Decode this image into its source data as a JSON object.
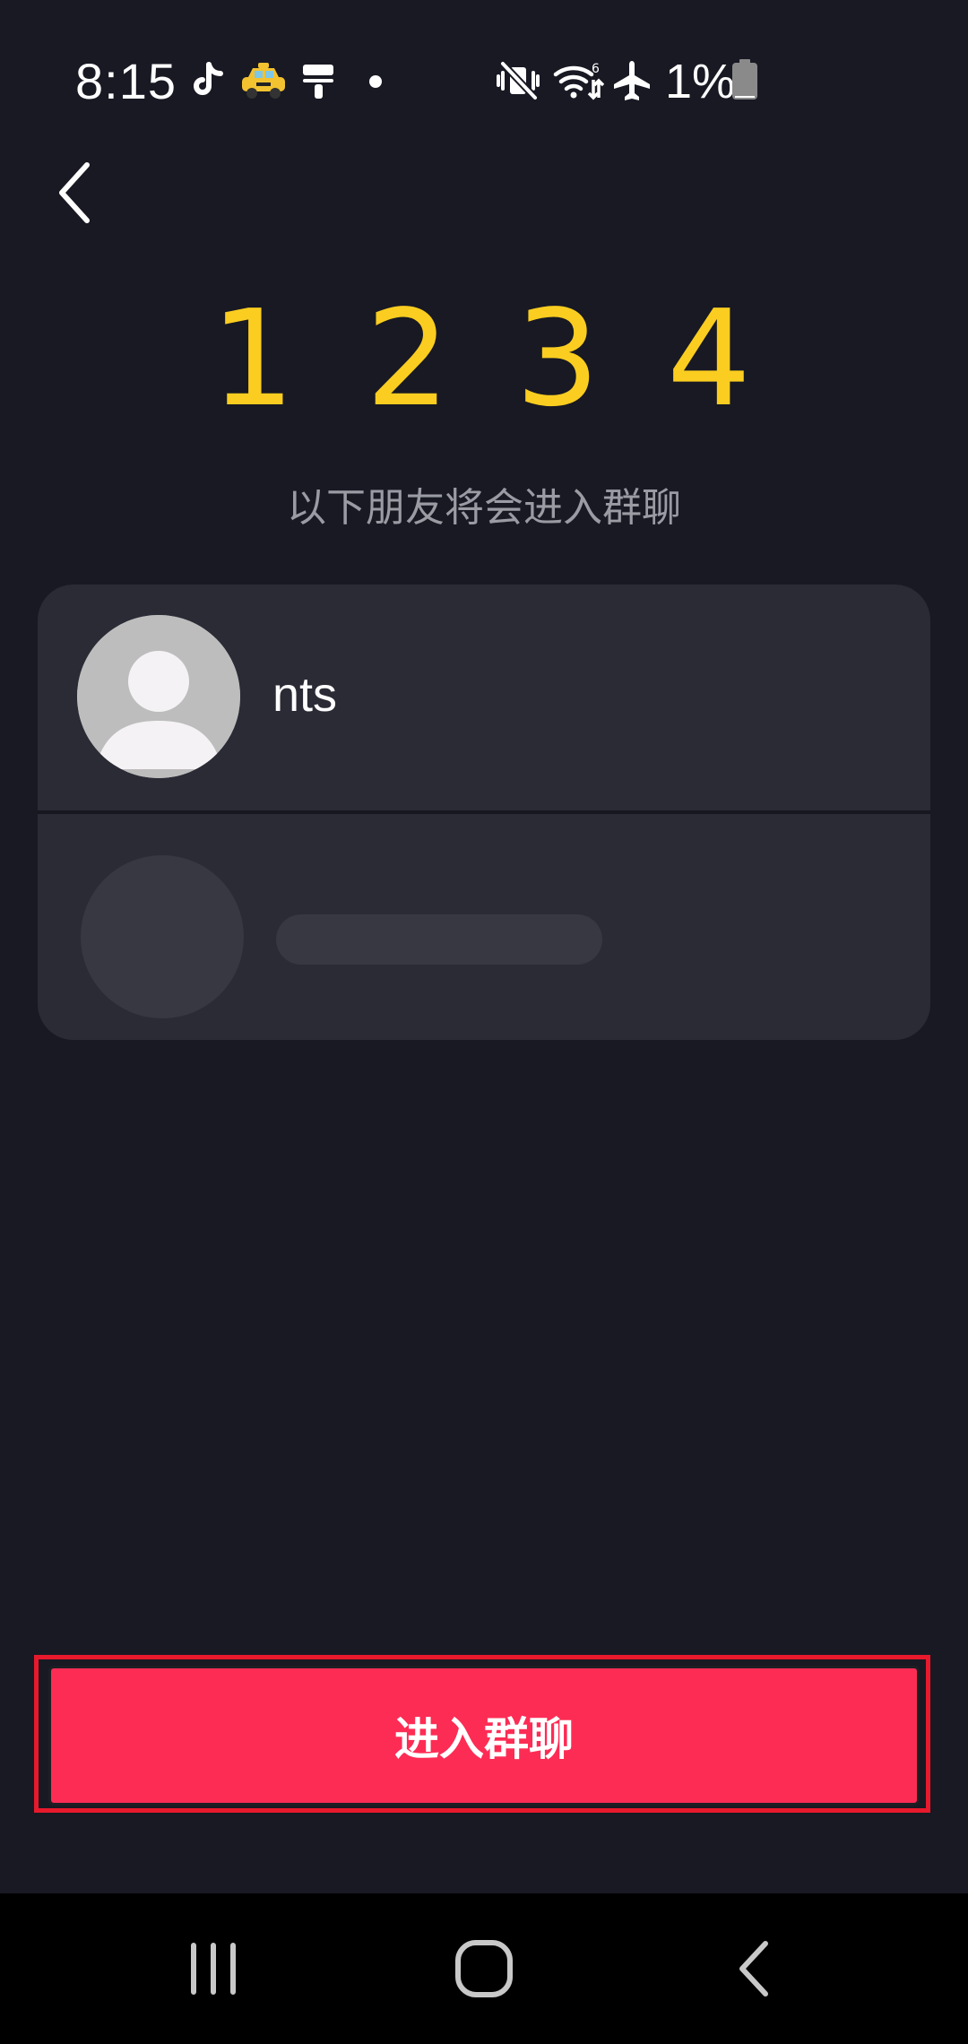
{
  "status_bar": {
    "time": "8:15",
    "battery_percent": "1%",
    "notification_icons": [
      "tiktok-icon",
      "taxi-icon",
      "paint-roller-icon",
      "more-dot-icon"
    ],
    "system_icons": [
      "vibrate-mute-icon",
      "wifi-6-icon",
      "airplane-mode-icon",
      "battery-low-icon"
    ]
  },
  "header": {
    "back_icon": "chevron-left-icon"
  },
  "code": {
    "digits": [
      "1",
      "2",
      "3",
      "4"
    ],
    "digit_color": "#facd20"
  },
  "subtitle": "以下朋友将会进入群聊",
  "members": [
    {
      "name": "nts",
      "avatar": "default-person-icon"
    }
  ],
  "placeholder_row": {
    "visible": true
  },
  "enter_button": {
    "label": "进入群聊",
    "color": "#fd2c55",
    "highlight_border": "#e8192c"
  },
  "nav_bar": {
    "buttons": [
      "recent-apps-icon",
      "home-icon",
      "back-icon"
    ]
  },
  "colors": {
    "background": "#181923",
    "card": "#2a2b35",
    "placeholder": "#383842",
    "subtitle_text": "#9a9ba3"
  }
}
